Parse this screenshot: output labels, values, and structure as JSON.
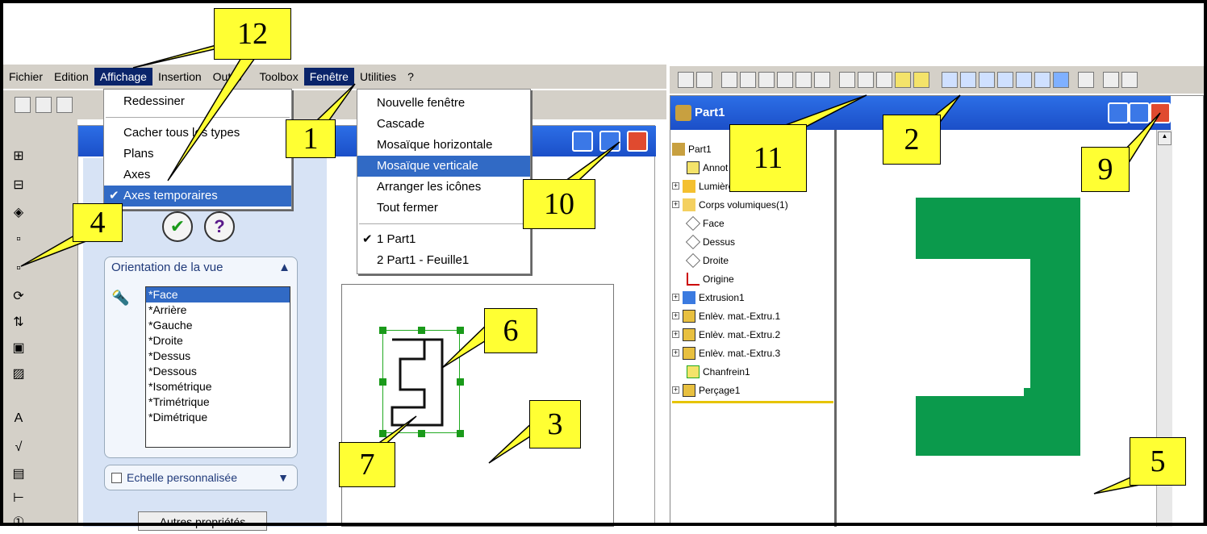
{
  "menubar": {
    "items": [
      "Fichier",
      "Edition",
      "Affichage",
      "Insertion",
      "Outils",
      "Toolbox",
      "Fenêtre",
      "Utilities",
      "?"
    ],
    "active_left": "Affichage",
    "active_right": "Fenêtre"
  },
  "affichage_menu": {
    "items": [
      "Redessiner",
      "Cacher tous les types",
      "Plans",
      "Axes",
      "Axes temporaires"
    ],
    "checked": "Axes temporaires"
  },
  "fenetre_menu": {
    "items": [
      "Nouvelle fenêtre",
      "Cascade",
      "Mosaïque horizontale",
      "Mosaïque verticale",
      "Arranger les icônes",
      "Tout fermer",
      "1 Part1",
      "2 Part1 - Feuille1"
    ],
    "highlighted": "Mosaïque verticale",
    "checked": "1 Part1"
  },
  "view_panel": {
    "section_title": "Orientation de la vue",
    "views": [
      "*Face",
      "*Arrière",
      "*Gauche",
      "*Droite",
      "*Dessus",
      "*Dessous",
      "*Isométrique",
      "*Trimétrique",
      "*Dimétrique"
    ],
    "selected": "*Face",
    "scale_label": "Echelle personnalisée",
    "more_button": "Autres propriétés"
  },
  "part_window": {
    "title": "Part1"
  },
  "feature_tree": {
    "nodes": [
      {
        "label": "Part1",
        "icon": "part-icon"
      },
      {
        "label": "Annot",
        "icon": "annotation-icon"
      },
      {
        "label": "Lumière",
        "icon": "light-icon"
      },
      {
        "label": "Corps volumiques(1)",
        "icon": "folder-icon"
      },
      {
        "label": "Face",
        "icon": "plane-icon"
      },
      {
        "label": "Dessus",
        "icon": "plane-icon"
      },
      {
        "label": "Droite",
        "icon": "plane-icon"
      },
      {
        "label": "Origine",
        "icon": "origin-icon"
      },
      {
        "label": "Extrusion1",
        "icon": "extrude-icon"
      },
      {
        "label": "Enlèv. mat.-Extru.1",
        "icon": "cut-icon"
      },
      {
        "label": "Enlèv. mat.-Extru.2",
        "icon": "cut-icon"
      },
      {
        "label": "Enlèv. mat.-Extru.3",
        "icon": "cut-icon"
      },
      {
        "label": "Chanfrein1",
        "icon": "chamfer-icon"
      },
      {
        "label": "Perçage1",
        "icon": "hole-icon"
      }
    ]
  },
  "callouts": [
    "12",
    "1",
    "4",
    "10",
    "11",
    "2",
    "9",
    "6",
    "3",
    "7",
    "5"
  ],
  "colors": {
    "callout": "#ffff33",
    "menu_highlight": "#316ac5",
    "title_bar": "#1b4fc8",
    "part_green": "#0b9a4c",
    "toolbar_gray": "#d4d0c8"
  }
}
